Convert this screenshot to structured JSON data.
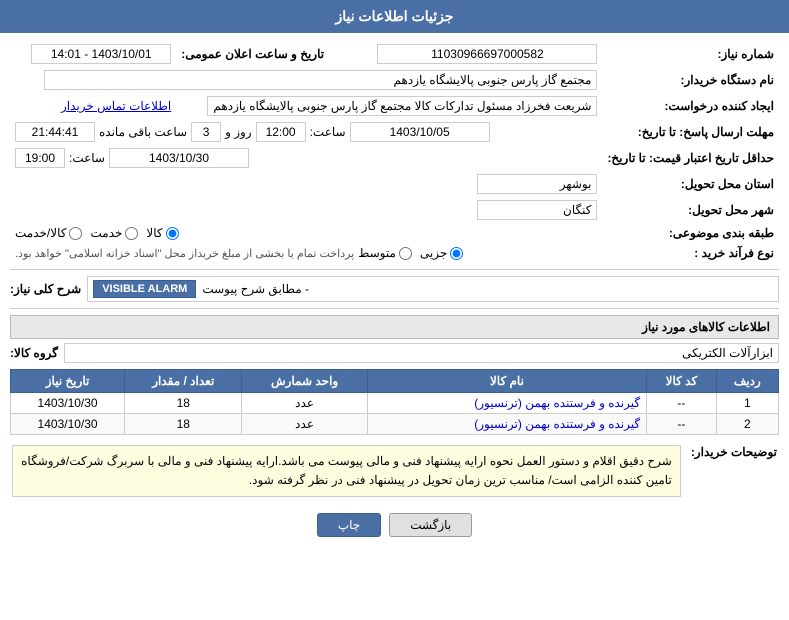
{
  "header": {
    "title": "جزئیات اطلاعات نیاز"
  },
  "fields": {
    "shomara_niaz_label": "شماره نیاز:",
    "shomara_niaz_value": "11030966697000582",
    "nam_dastgah_label": "نام دستگاه خریدار:",
    "nam_dastgah_value": "مجتمع گاز پارس جنوبی  پالایشگاه یازدهم",
    "ejad_konande_label": "ایجاد کننده درخواست:",
    "ejad_konande_value": "شریعت فخرزاد مسئول تدارکات کالا مجتمع گاز پارس جنوبی  پالایشگاه یازدهم",
    "ettelaat_tamas_label": "اطلاعات تماس خریدار",
    "mohlat_ersal_label": "مهلت ارسال پاسخ: تا تاریخ:",
    "mohlat_ersal_date": "1403/10/05",
    "mohlat_ersal_saat_label": "ساعت:",
    "mohlat_ersal_saat": "12:00",
    "mohlat_ersal_roz_label": "روز و",
    "mohlat_ersal_roz": "3",
    "mohlat_ersal_mande_label": "ساعت باقی مانده",
    "mohlat_ersal_baqi": "21:44:41",
    "haداقل_label": "حداقل تاریخ اعتبار قیمت: تا تاریخ:",
    "hadaqal_date": "1403/10/30",
    "hadaqal_saat_label": "ساعت:",
    "hadaqal_saat": "19:00",
    "ostan_label": "استان محل تحویل:",
    "ostan_value": "بوشهر",
    "shahr_label": "شهر محل تحویل:",
    "shahr_value": "کنگان",
    "tabaqa_label": "طبقه بندی موضوعی:",
    "tabaqa_options": [
      "کالا",
      "خدمت",
      "کالا/خدمت"
    ],
    "tabaqa_selected": "کالا",
    "nav_farand_label": "نوع فرآند خرید :",
    "nav_farand_options": [
      "جزیی",
      "متوسط"
    ],
    "nav_farand_note": "پرداخت تمام یا بخشی از مبلغ خریداز محل \"اسناد خزانه اسلامی\" خواهد بود.",
    "tarikh_va_saat_label": "تاریخ و ساعت اعلان عمومی:",
    "tarikh_va_saat_value": "1403/10/01 - 14:01"
  },
  "sharh_koli": {
    "label": "شرح کلی نیاز:",
    "badge": "VISIBLE ALARM",
    "badge_prefix": "- مطابق شرح پیوست",
    "box_content": ""
  },
  "kalaha": {
    "section_title": "اطلاعات کالاهای مورد نیاز",
    "group_label": "گروه کالا:",
    "group_value": "ابزارآلات الکتریکی",
    "table_headers": [
      "ردیف",
      "کد کالا",
      "نام کالا",
      "واحد شمارش",
      "تعداد / مقدار",
      "تاریخ نیاز"
    ],
    "rows": [
      {
        "radif": "1",
        "kod": "--",
        "name": "گیرنده و فرستنده بهمن (ترنسیور)",
        "vahed": "عدد",
        "tedad": "18",
        "tarikh": "1403/10/30"
      },
      {
        "radif": "2",
        "kod": "--",
        "name": "گیرنده و فرستنده بهمن (ترنسیور)",
        "vahed": "عدد",
        "tedad": "18",
        "tarikh": "1403/10/30"
      }
    ]
  },
  "tawzih_khardar": {
    "label": "توضیحات خریدار:",
    "text": "شرح دقیق اقلام و دستور العمل نحوه ارایه پیشنهاد فنی و مالی پیوست می باشد.ارایه پیشنهاد فنی و مالی با سربرگ شرکت/فروشگاه تامین کننده الزامی است/ مناسب ترین زمان تحویل در پیشنهاد فنی در نظر گرفته شود."
  },
  "buttons": {
    "print": "چاپ",
    "back": "بازگشت"
  }
}
